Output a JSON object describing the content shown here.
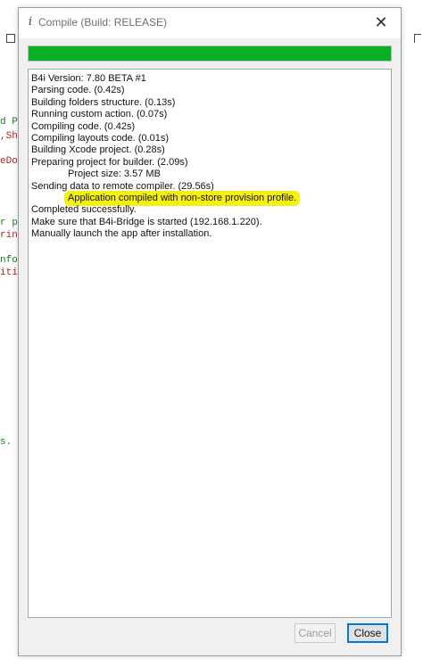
{
  "window": {
    "title": "Compile (Build: RELEASE)",
    "title_icon_glyph": "i",
    "close_glyph": "✕"
  },
  "progress": {
    "fraction": 1.0,
    "color": "#06b025"
  },
  "log": {
    "lines": [
      {
        "text": "B4i Version: 7.80 BETA #1",
        "style": "normal"
      },
      {
        "text": "Parsing code.    (0.42s)",
        "style": "normal"
      },
      {
        "text": "Building folders structure.    (0.13s)",
        "style": "normal"
      },
      {
        "text": "Running custom action.    (0.07s)",
        "style": "normal"
      },
      {
        "text": "Compiling code.    (0.42s)",
        "style": "normal"
      },
      {
        "text": "Compiling layouts code.    (0.01s)",
        "style": "normal"
      },
      {
        "text": "Building Xcode project.    (0.28s)",
        "style": "normal"
      },
      {
        "text": "Preparing project for builder.    (2.09s)",
        "style": "normal"
      },
      {
        "text": "Project size: 3.57 MB",
        "style": "indent"
      },
      {
        "text": "Sending data to remote compiler.    (29.56s)",
        "style": "normal"
      },
      {
        "text": "Application compiled with non-store provision profile.",
        "style": "highlight"
      },
      {
        "text": "Completed successfully.",
        "style": "normal"
      },
      {
        "text": "Make sure that B4i-Bridge is started (192.168.1.220).",
        "style": "normal"
      },
      {
        "text": "Manually launch the app after installation.",
        "style": "normal"
      }
    ],
    "highlight_color": "#f5f00f"
  },
  "buttons": {
    "cancel_label": "Cancel",
    "close_label": "Close"
  },
  "background_ide": {
    "fragments": [
      {
        "text": "d Po",
        "color": "#1a7f1a"
      },
      {
        "text": ",Sha",
        "color": "#b22222"
      },
      {
        "text": "eDow",
        "color": "#b22222"
      },
      {
        "text": "r ph",
        "color": "#1a7f1a"
      },
      {
        "text": "ring",
        "color": "#b22222"
      },
      {
        "text": "nfor",
        "color": "#1a7f1a"
      },
      {
        "text": "itio",
        "color": "#b22222"
      },
      {
        "text": "s.",
        "color": "#1a7f1a"
      }
    ]
  }
}
